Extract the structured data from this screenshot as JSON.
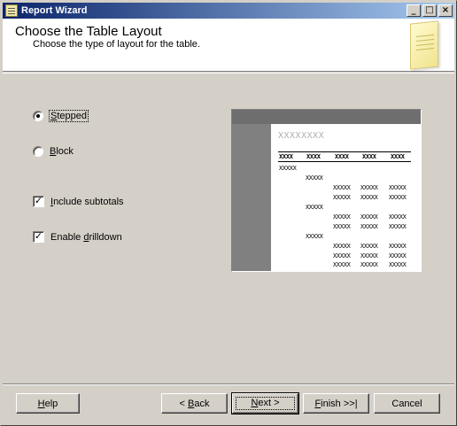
{
  "window": {
    "title": "Report Wizard",
    "controls": {
      "minimize": "_",
      "maximize": "□",
      "close": "×"
    }
  },
  "header": {
    "title": "Choose the Table Layout",
    "subtitle": "Choose the type of layout for the table."
  },
  "options": {
    "stepped": {
      "label": "Stepped",
      "accel": "S",
      "rest": "tepped",
      "checked": true
    },
    "block": {
      "label": "Block",
      "accel": "B",
      "rest": "lock",
      "checked": false
    },
    "subtotals": {
      "label": "Include subtotals",
      "accel": "I",
      "rest": "nclude subtotals",
      "checked": true
    },
    "drilldown": {
      "label": "Enable drilldown",
      "pre": "Enable ",
      "accel": "d",
      "rest": "rilldown",
      "checked": true
    }
  },
  "preview": {
    "title": "XXXXXXXX",
    "header_cells": [
      "XXXX",
      "XXXX",
      "XXXX",
      "XXXX",
      "XXXX"
    ],
    "group1": "XXXXX",
    "group2": "XXXXX",
    "detail": "XXXXX"
  },
  "buttons": {
    "help": {
      "accel": "H",
      "rest": "elp"
    },
    "back": {
      "pre": "< ",
      "accel": "B",
      "rest": "ack"
    },
    "next": {
      "accel": "N",
      "rest": "ext >"
    },
    "finish": {
      "accel": "F",
      "rest": "inish >>|"
    },
    "cancel": {
      "label": "Cancel"
    }
  }
}
